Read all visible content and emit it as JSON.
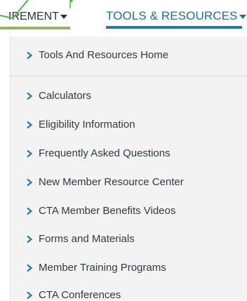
{
  "nav": {
    "tabs": [
      {
        "label": "IREMENT",
        "accent": "#8fb35f"
      },
      {
        "label": "TOOLS & RESOURCES",
        "accent": "#2a79a5"
      }
    ]
  },
  "dropdown": {
    "home_item": "Tools And Resources Home",
    "items": [
      "Calculators",
      "Eligibility Information",
      "Frequently Asked Questions",
      "New Member Resource Center",
      "CTA Member Benefits Videos",
      "Forms and Materials",
      "Member Training Programs",
      "CTA Conferences"
    ]
  },
  "colors": {
    "chevron": "#2a79a5",
    "menu_background": "#f3f3f3",
    "link_text": "#1f6f9c"
  },
  "icons": {
    "menu_bullet": "chevron-right-icon",
    "tab_dropdown": "caret-down-icon"
  }
}
